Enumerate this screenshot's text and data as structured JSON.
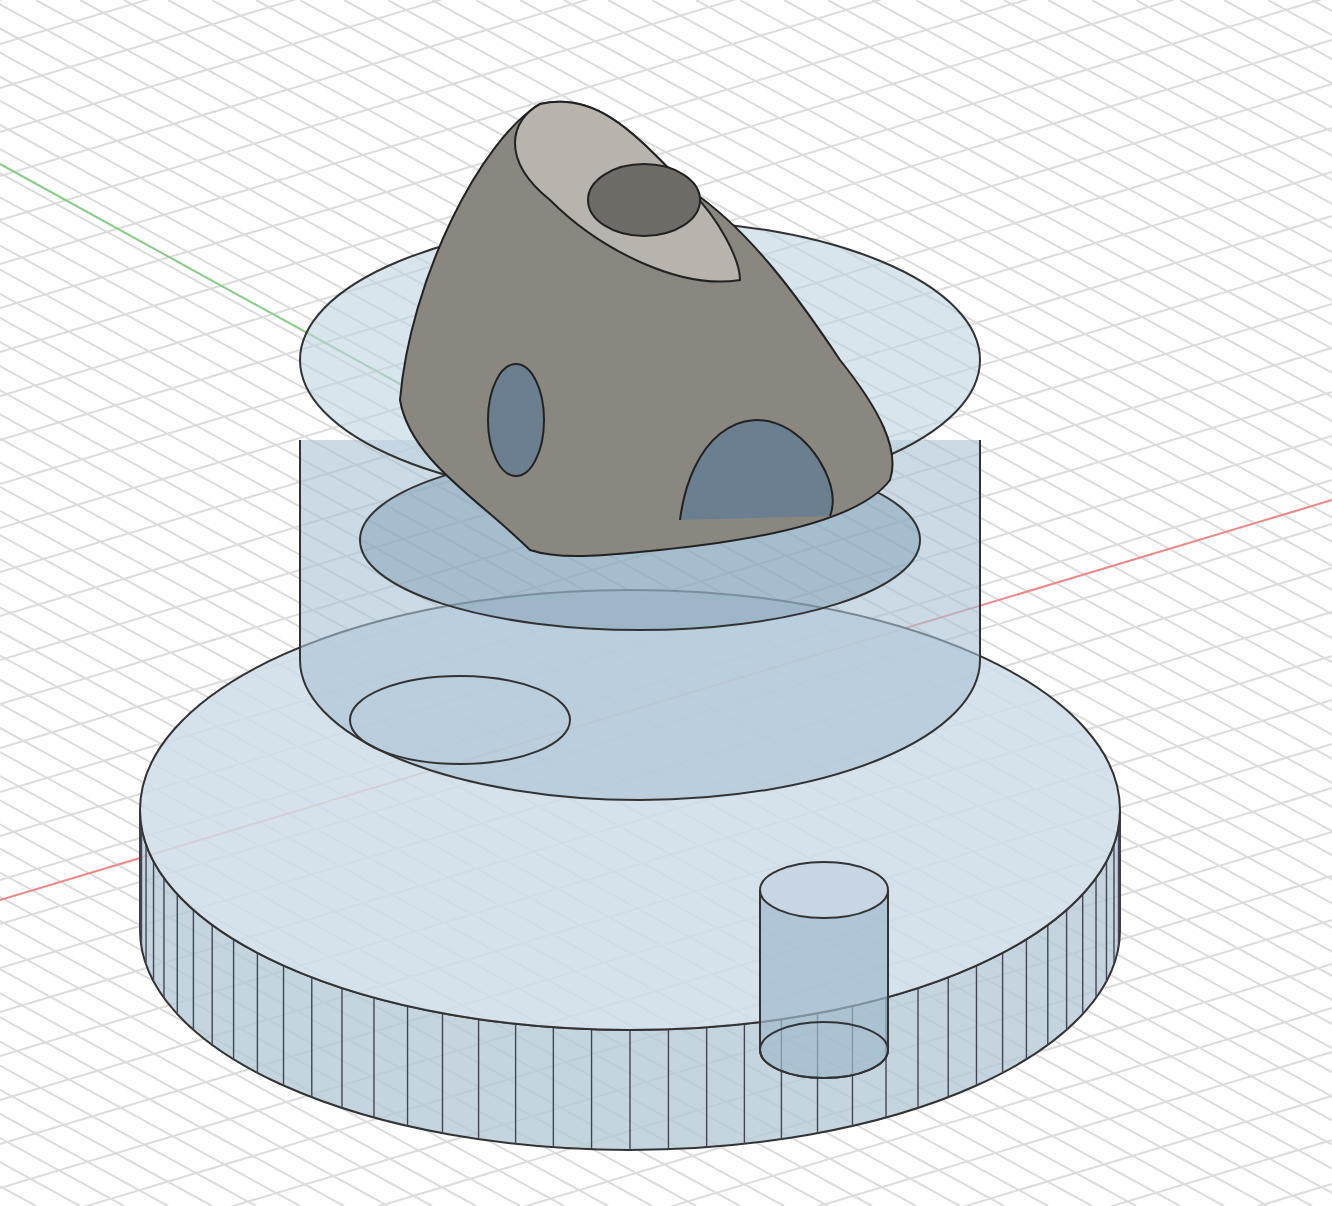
{
  "viewport": {
    "kind": "model",
    "grid": true
  }
}
